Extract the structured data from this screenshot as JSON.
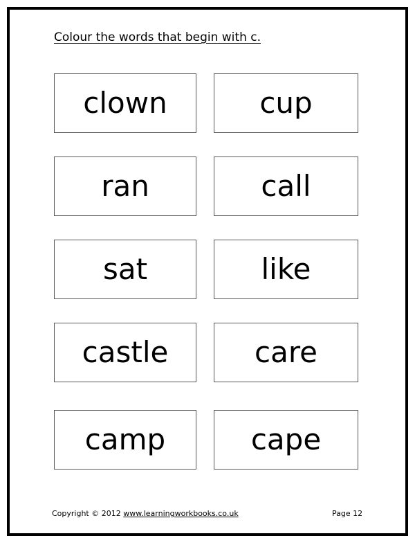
{
  "instruction": "Colour the words that begin with c.",
  "words": [
    {
      "text": "clown",
      "begins_with_c": true
    },
    {
      "text": "cup",
      "begins_with_c": true
    },
    {
      "text": "ran",
      "begins_with_c": false
    },
    {
      "text": "call",
      "begins_with_c": true
    },
    {
      "text": "sat",
      "begins_with_c": false
    },
    {
      "text": "like",
      "begins_with_c": false
    },
    {
      "text": "castle",
      "begins_with_c": true
    },
    {
      "text": "care",
      "begins_with_c": true
    },
    {
      "text": "camp",
      "begins_with_c": true
    },
    {
      "text": "cape",
      "begins_with_c": true
    }
  ],
  "footer": {
    "copyright": "Copyright © 2012",
    "website": "www.learningworkbooks.co.uk",
    "page": "Page 12"
  }
}
